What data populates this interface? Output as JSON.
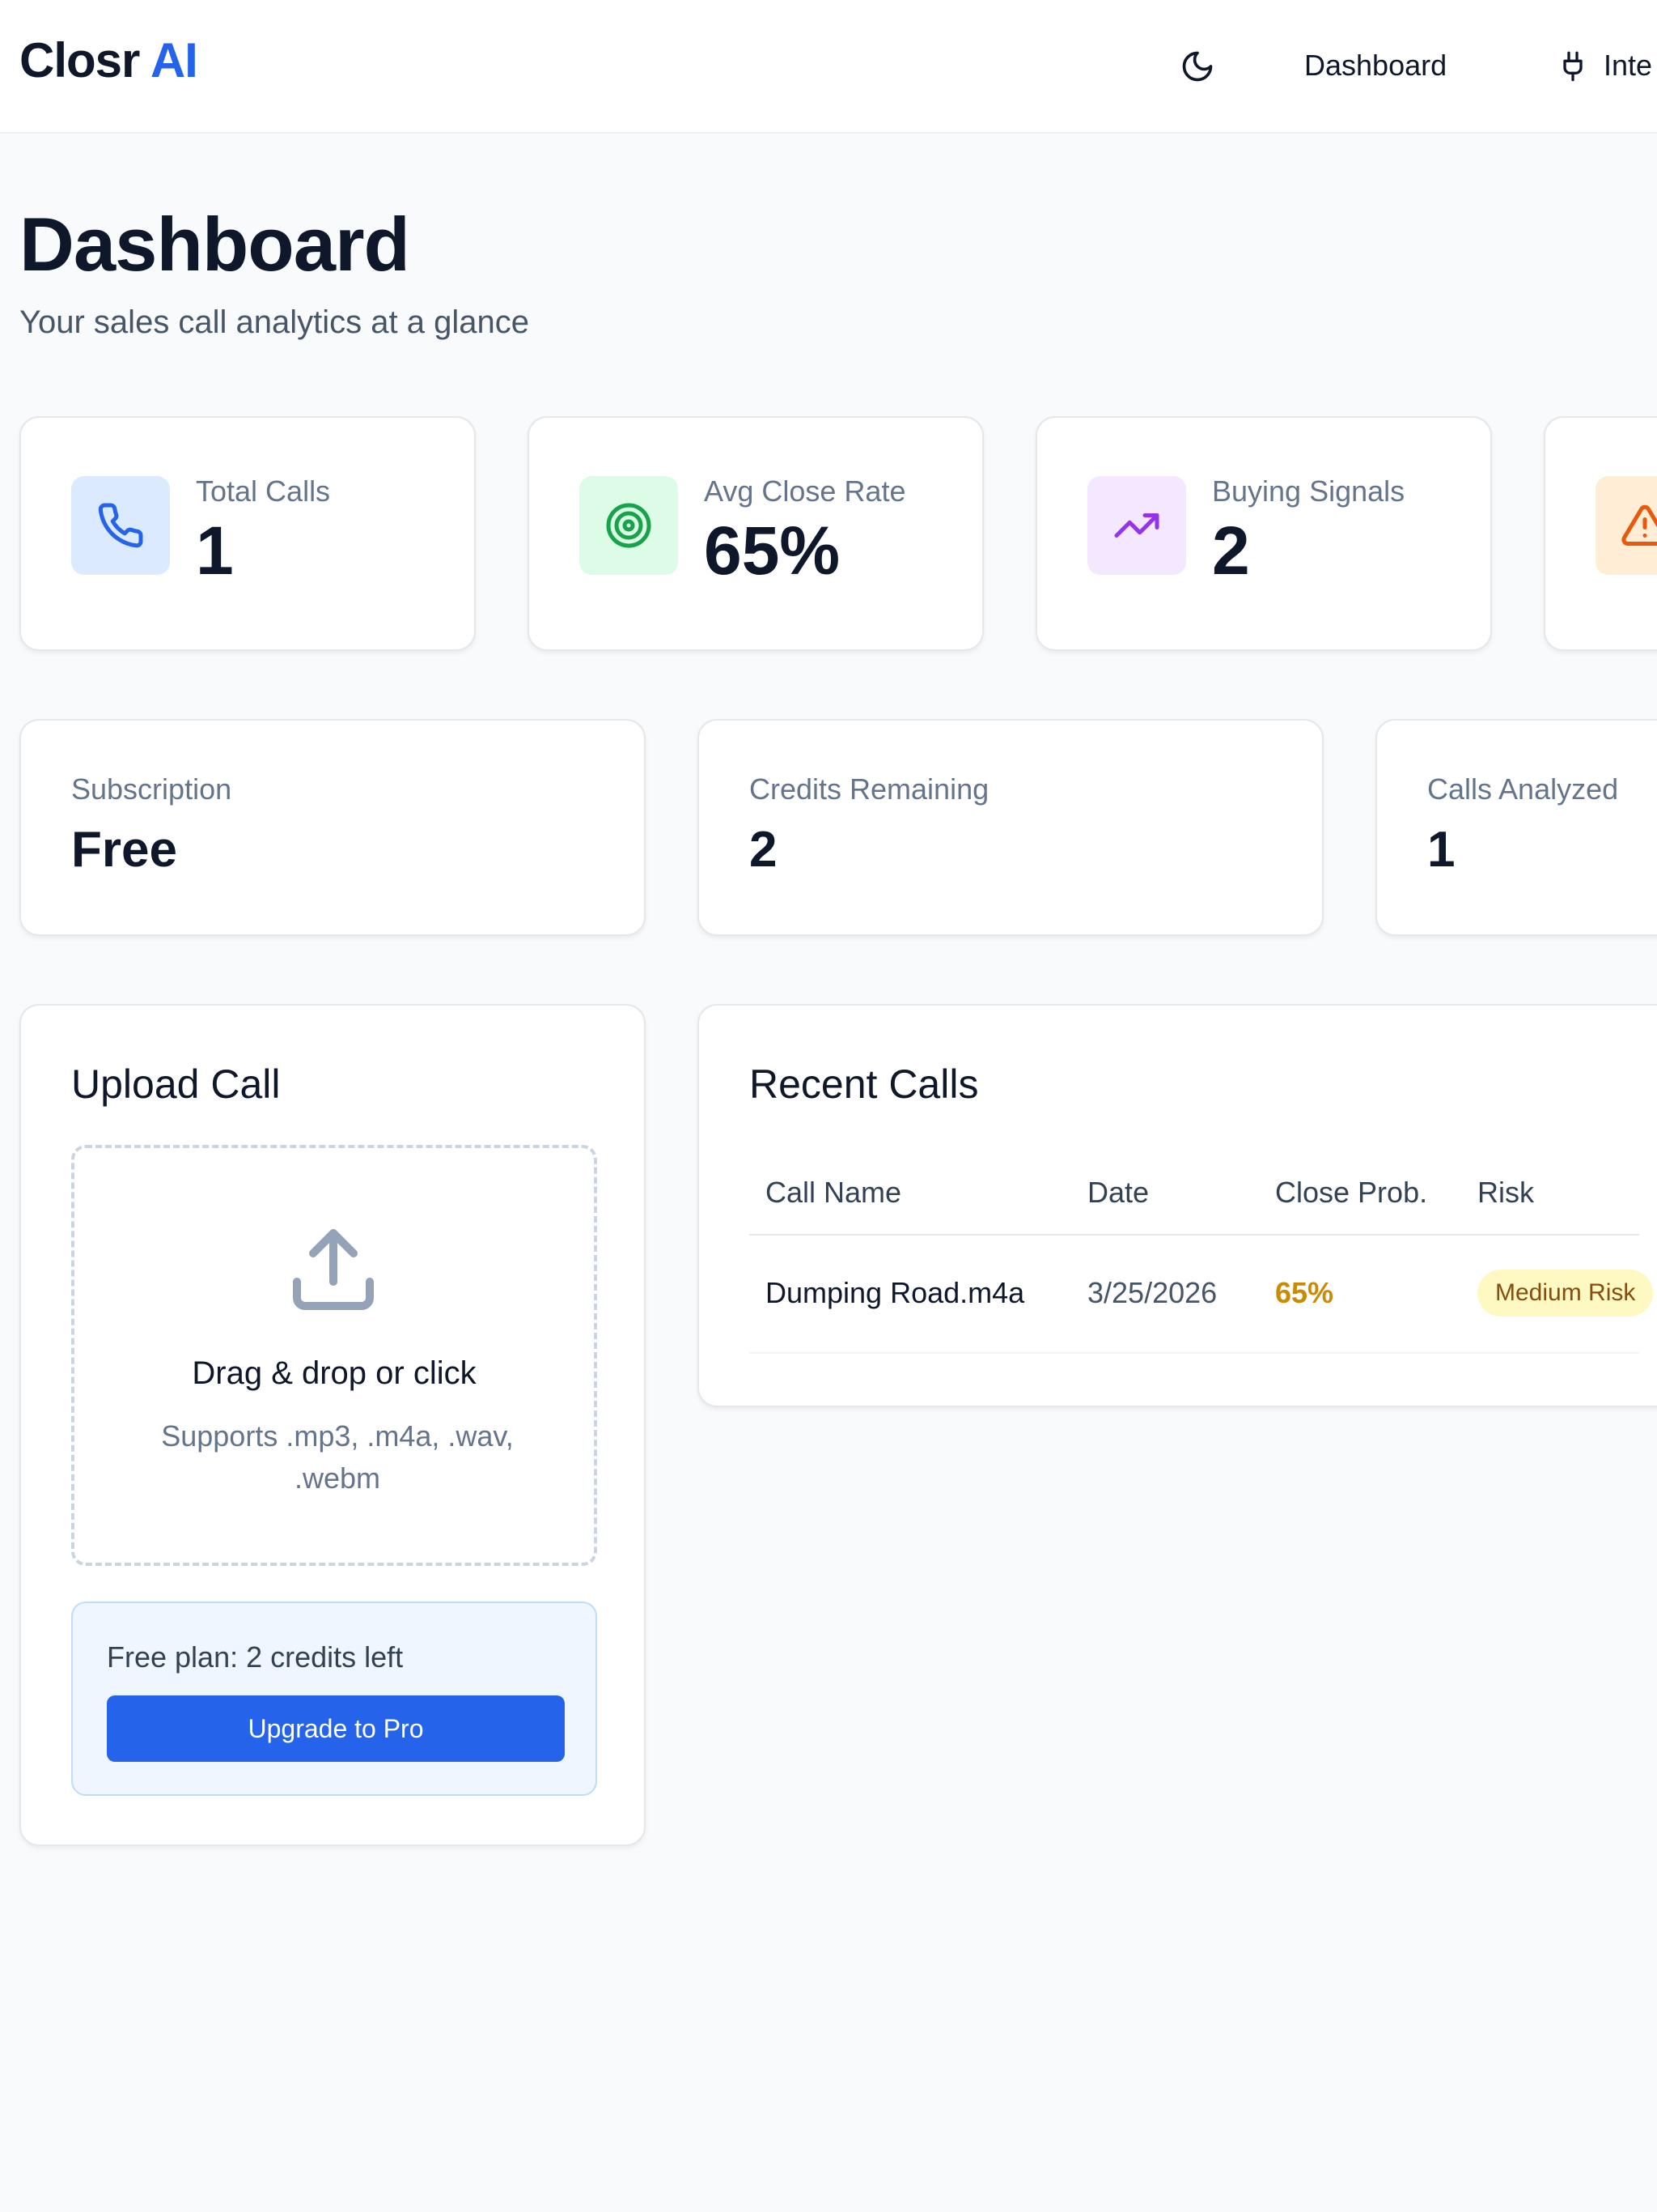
{
  "header": {
    "logo_main": "Closr",
    "logo_accent": " AI",
    "nav": [
      {
        "label": "Dashboard",
        "icon": ""
      },
      {
        "label": "Inte",
        "icon": "plug-icon"
      }
    ],
    "theme_icon": "moon-icon"
  },
  "page": {
    "title": "Dashboard",
    "subtitle": "Your sales call analytics at a glance"
  },
  "stats": [
    {
      "label": "Total Calls",
      "value": "1",
      "icon": "phone-icon",
      "icon_bg": "#dbeafe",
      "icon_color": "#2563eb"
    },
    {
      "label": "Avg Close Rate",
      "value": "65%",
      "icon": "target-icon",
      "icon_bg": "#dcfce7",
      "icon_color": "#16a34a"
    },
    {
      "label": "Buying Signals",
      "value": "2",
      "icon": "trending-up-icon",
      "icon_bg": "#f3e8ff",
      "icon_color": "#9333ea"
    },
    {
      "label": "",
      "value": "",
      "icon": "alert-triangle-icon",
      "icon_bg": "#ffedd5",
      "icon_color": "#ea580c"
    }
  ],
  "account": [
    {
      "label": "Subscription",
      "value": "Free"
    },
    {
      "label": "Credits Remaining",
      "value": "2"
    },
    {
      "label": "Calls Analyzed",
      "value": "1"
    }
  ],
  "upload": {
    "title": "Upload Call",
    "icon": "upload-icon",
    "drop_title": "Drag & drop or click",
    "drop_sub": "Supports .mp3, .m4a, .wav, .webm",
    "plan_text": "Free plan: 2 credits left",
    "upgrade_label": "Upgrade to Pro"
  },
  "recent": {
    "title": "Recent Calls",
    "columns": [
      "Call Name",
      "Date",
      "Close Prob.",
      "Risk"
    ],
    "rows": [
      {
        "name": "Dumping Road.m4a",
        "date": "3/25/2026",
        "prob": "65%",
        "risk": "Medium Risk"
      }
    ]
  },
  "colors": {
    "brand": "#2563eb",
    "prob_medium": "#ca8a04",
    "badge_medium_bg": "#fef9c3",
    "badge_medium_text": "#854d0e"
  }
}
